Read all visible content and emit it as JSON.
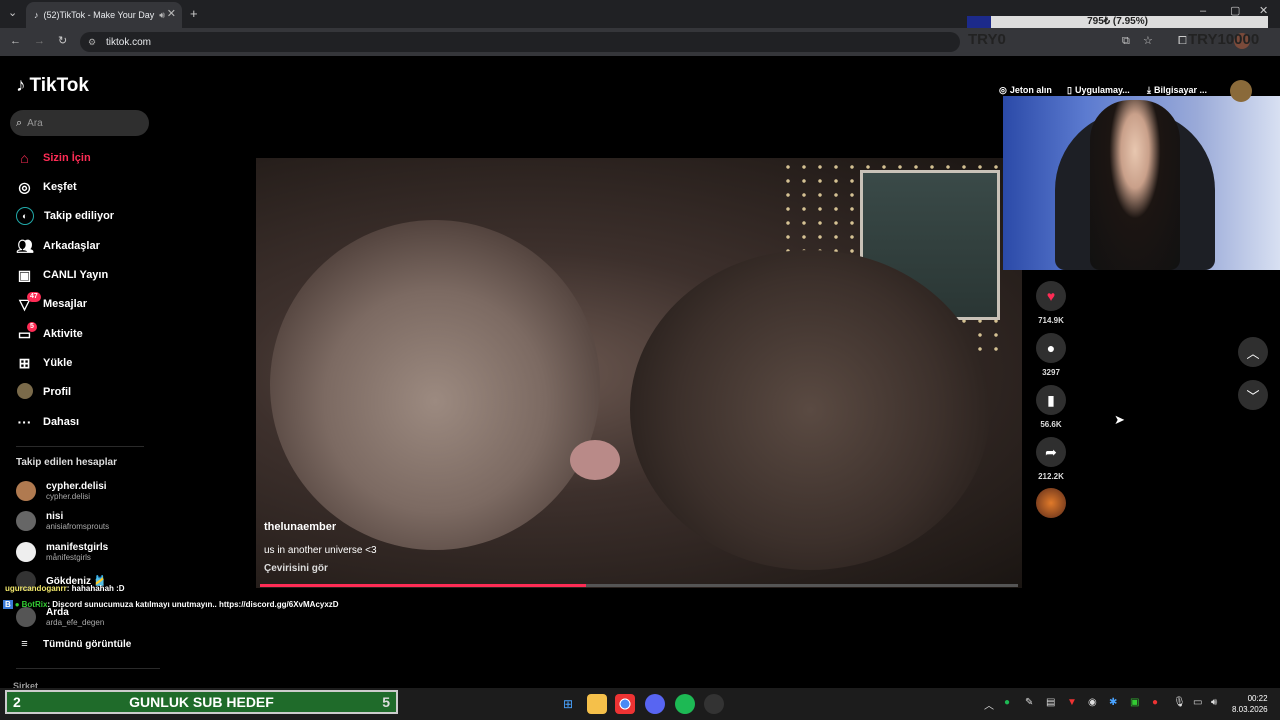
{
  "browser": {
    "tab_title": "(52)TikTok - Make Your Day",
    "url": "tiktok.com"
  },
  "donation_goal": {
    "label": "795₺ (7.95%)",
    "left": "TRY0",
    "right": "TRY10000",
    "progress": 0.0795
  },
  "sidebar": {
    "logo": "TikTok",
    "search_placeholder": "Ara",
    "nav": [
      {
        "label": "Sizin İçin",
        "icon": "home-icon"
      },
      {
        "label": "Keşfet",
        "icon": "compass-icon"
      },
      {
        "label": "Takip ediliyor",
        "icon": "following-icon"
      },
      {
        "label": "Arkadaşlar",
        "icon": "friends-icon"
      },
      {
        "label": "CANLI Yayın",
        "icon": "live-icon"
      },
      {
        "label": "Mesajlar",
        "icon": "messages-icon",
        "badge": "47"
      },
      {
        "label": "Aktivite",
        "icon": "activity-icon",
        "badge": "5"
      },
      {
        "label": "Yükle",
        "icon": "upload-icon"
      },
      {
        "label": "Profil",
        "icon": "profile-icon"
      },
      {
        "label": "Dahası",
        "icon": "more-icon"
      }
    ],
    "following_title": "Takip edilen hesaplar",
    "accounts": [
      {
        "name": "cypher.delisi",
        "handle": "cypher.delisi"
      },
      {
        "name": "nisi",
        "handle": "anisiafromsprouts"
      },
      {
        "name": "manifestgirls",
        "handle": "månifestgirls"
      },
      {
        "name": "Gökdeniz 🎽",
        "handle": ""
      },
      {
        "name": "Arda",
        "handle": "arda_efe_degen"
      }
    ],
    "see_all": "Tümünü görüntüle",
    "company": "Şirket"
  },
  "top_buttons": {
    "coins": "Jeton alın",
    "app": "Uygulamay...",
    "desktop": "Bilgisayar ..."
  },
  "video": {
    "author": "thelunaember",
    "description": "us in another universe <3",
    "translate": "Çevirisini gör",
    "progress": 0.43
  },
  "actions": {
    "likes": "714.9K",
    "comments": "3297",
    "saves": "56.6K",
    "shares": "212.2K"
  },
  "chat": [
    {
      "user": "ugurcandoganrr",
      "text": ": hahahahah :D"
    },
    {
      "user": "BotRix",
      "text": ": Discord sunucumuza katılmayı unutmayın.. https://discord.gg/6XvMAcyxzD"
    }
  ],
  "sub_goal": {
    "current": "2",
    "title": "GUNLUK SUB HEDEF",
    "target": "5"
  },
  "taskbar": {
    "time": "00:22",
    "date": "8.03.2026"
  },
  "colors": {
    "accent": "#fe2c55",
    "chat_user": "#f2e86b",
    "sub_bar": "#1f6b2a"
  }
}
